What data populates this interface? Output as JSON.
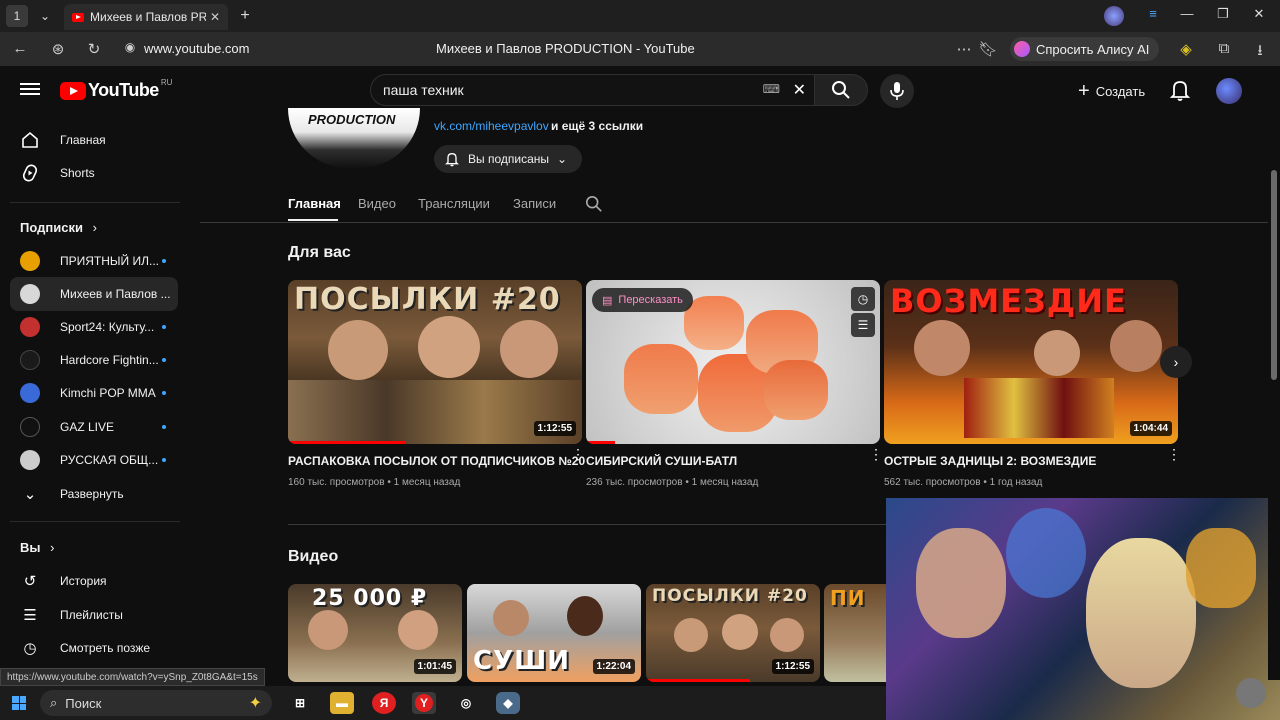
{
  "browser": {
    "tab_title": "Михеев и Павлов PRODUCTION - YouTube",
    "tab_count": "1",
    "url": "www.youtube.com",
    "page_title": "Михеев и Павлов PRODUCTION - YouTube",
    "alice_label": "Спросить Алису AI",
    "status_url": "https://www.youtube.com/watch?v=ySnp_Z0t8GA&t=15s"
  },
  "header": {
    "logo_text": "YouTube",
    "region": "RU",
    "search_value": "паша техник",
    "create_label": "Создать"
  },
  "sidebar": {
    "main_items": [
      {
        "label": "Главная",
        "icon": "home-icon"
      },
      {
        "label": "Shorts",
        "icon": "shorts-icon"
      }
    ],
    "subscriptions_heading": "Подписки",
    "subscriptions": [
      {
        "label": "ПРИЯТНЫЙ ИЛ...",
        "color": "#e8a000",
        "dot": true
      },
      {
        "label": "Михеев и Павлов ...",
        "color": "#d8d8d8",
        "dot": false
      },
      {
        "label": "Sport24: Культу...",
        "color": "#c23030",
        "dot": true
      },
      {
        "label": "Hardcore Fightin...",
        "color": "#1a1a1a",
        "dot": true
      },
      {
        "label": "Kimchi POP MMA",
        "color": "#3a6ad8",
        "dot": true
      },
      {
        "label": "GAZ LIVE",
        "color": "#111111",
        "dot": true
      },
      {
        "label": "РУССКАЯ ОБЩ...",
        "color": "#cccccc",
        "dot": true
      }
    ],
    "expand_label": "Развернуть",
    "you_heading": "Вы",
    "you_items": [
      {
        "label": "История",
        "icon": "history-icon"
      },
      {
        "label": "Плейлисты",
        "icon": "playlists-icon"
      },
      {
        "label": "Смотреть позже",
        "icon": "watch-later-icon"
      }
    ]
  },
  "channel": {
    "avatar_text": "PRODUCTION",
    "link": "vk.com/miheevpavlov",
    "more_links": "и ещё 3 ссылки",
    "subscribed_label": "Вы подписаны",
    "tabs": [
      "Главная",
      "Видео",
      "Трансляции",
      "Записи"
    ]
  },
  "for_you": {
    "title": "Для вас",
    "retell_label": "Пересказать",
    "videos": [
      {
        "title": "РАСПАКОВКА ПОСЫЛОК ОТ ПОДПИСЧИКОВ №20",
        "views": "160 тыс. просмотров",
        "age": "1 месяц назад",
        "duration": "1:12:55",
        "overlay": "ПОСЫЛКИ #20",
        "progress": 0.4
      },
      {
        "title": "СИБИРСКИЙ СУШИ-БАТЛ",
        "views": "236 тыс. просмотров",
        "age": "1 месяц назад",
        "duration": "",
        "overlay": "",
        "progress": 0.1
      },
      {
        "title": "ОСТРЫЕ ЗАДНИЦЫ 2: ВОЗМЕЗДИЕ",
        "views": "562 тыс. просмотров",
        "age": "1 год назад",
        "duration": "1:04:44",
        "overlay": "ВОЗМЕЗДИЕ",
        "progress": 0
      }
    ]
  },
  "videos_section": {
    "title": "Видео",
    "thumbs": [
      {
        "overlay": "25 000 ₽",
        "duration": "1:01:45"
      },
      {
        "overlay": "СУШИ",
        "duration": "1:22:04"
      },
      {
        "overlay": "ПОСЫЛКИ #20",
        "duration": "1:12:55"
      },
      {
        "overlay": "ПИ",
        "duration": ""
      }
    ]
  },
  "taskbar": {
    "search_label": "Поиск"
  },
  "colors": {
    "accent": "#ff0000",
    "link": "#3ea6ff"
  }
}
